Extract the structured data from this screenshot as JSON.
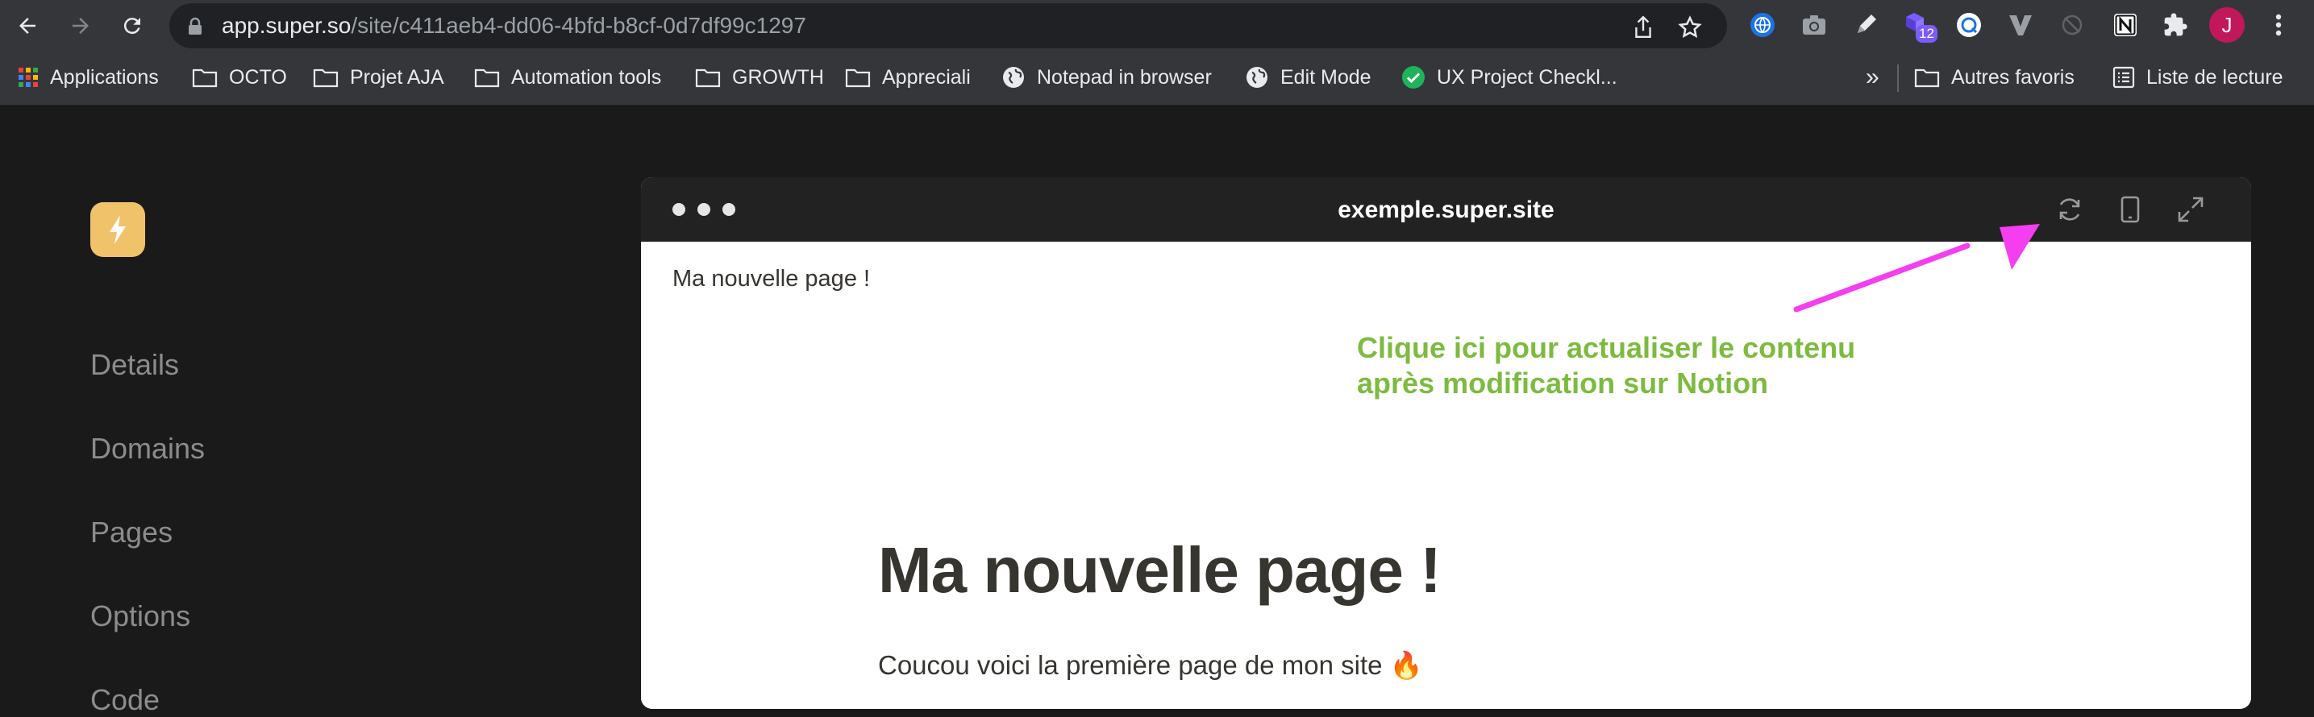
{
  "browser": {
    "url_host": "app.super.so",
    "url_path": "/site/c411aeb4-dd06-4bfd-b8cf-0d7df99c1297",
    "extension_badge": "12",
    "profile_initial": "J",
    "bookmarks": [
      {
        "label": "Applications",
        "icon": "apps-grid-icon"
      },
      {
        "label": "OCTO",
        "icon": "folder-icon"
      },
      {
        "label": "Projet AJA",
        "icon": "folder-icon"
      },
      {
        "label": "Automation tools",
        "icon": "folder-icon"
      },
      {
        "label": "GROWTH",
        "icon": "folder-icon"
      },
      {
        "label": "Appreciali",
        "icon": "folder-icon"
      },
      {
        "label": "Notepad in browser",
        "icon": "globe-icon"
      },
      {
        "label": "Edit Mode",
        "icon": "globe-icon"
      },
      {
        "label": "UX Project Checkl...",
        "icon": "check-circle-icon"
      }
    ],
    "bookmarks_overflow": "»",
    "other_bookmarks": "Autres favoris",
    "reading_list": "Liste de lecture"
  },
  "app": {
    "sidebar": {
      "items": [
        {
          "label": "Details"
        },
        {
          "label": "Domains"
        },
        {
          "label": "Pages"
        },
        {
          "label": "Options"
        },
        {
          "label": "Code"
        }
      ]
    },
    "preview": {
      "url": "exemple.super.site",
      "page_breadcrumb": "Ma nouvelle page !",
      "page_title": "Ma nouvelle page !",
      "page_text": "Coucou voici la première page de mon site 🔥"
    },
    "annotation": {
      "line1": "Clique ici pour actualiser le contenu",
      "line2": "après modification sur Notion"
    }
  },
  "colors": {
    "chrome_bg": "#35363a",
    "app_bg": "#1a1a1a",
    "logo_bg": "#f0c36a",
    "annotation": "#7cbb3f",
    "arrow": "#f53ef0"
  }
}
